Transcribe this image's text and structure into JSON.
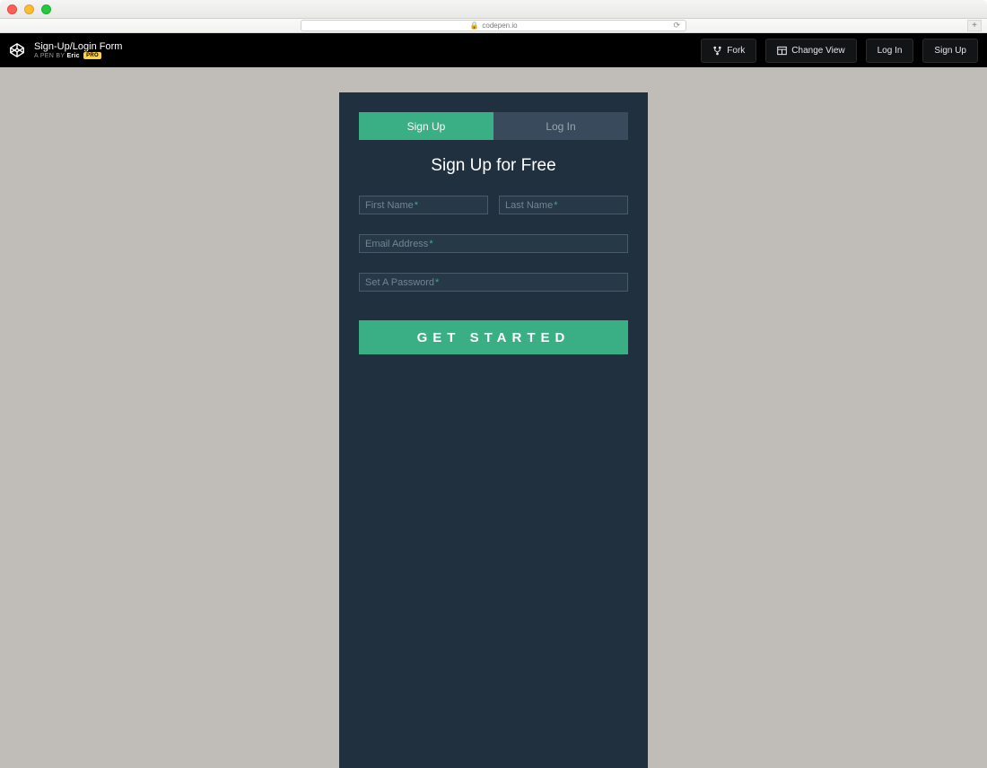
{
  "browser": {
    "url_display": "codepen.io"
  },
  "codepen_header": {
    "pen_title": "Sign-Up/Login Form",
    "subtitle_prefix": "A PEN BY",
    "author": "Eric",
    "pro_badge": "PRO",
    "buttons": {
      "fork": "Fork",
      "change_view": "Change View",
      "login": "Log In",
      "signup": "Sign Up"
    }
  },
  "form": {
    "tabs": {
      "signup": "Sign Up",
      "login": "Log In"
    },
    "title": "Sign Up for Free",
    "fields": {
      "first_name": {
        "placeholder": "First Name",
        "required_marker": "*"
      },
      "last_name": {
        "placeholder": "Last Name",
        "required_marker": "*"
      },
      "email": {
        "placeholder": "Email Address",
        "required_marker": "*"
      },
      "password": {
        "placeholder": "Set A Password",
        "required_marker": "*"
      }
    },
    "submit_label": "GET STARTED"
  },
  "colors": {
    "accent": "#3aaf85",
    "card_bg": "#20303f",
    "preview_bg": "#c0bdb8"
  }
}
